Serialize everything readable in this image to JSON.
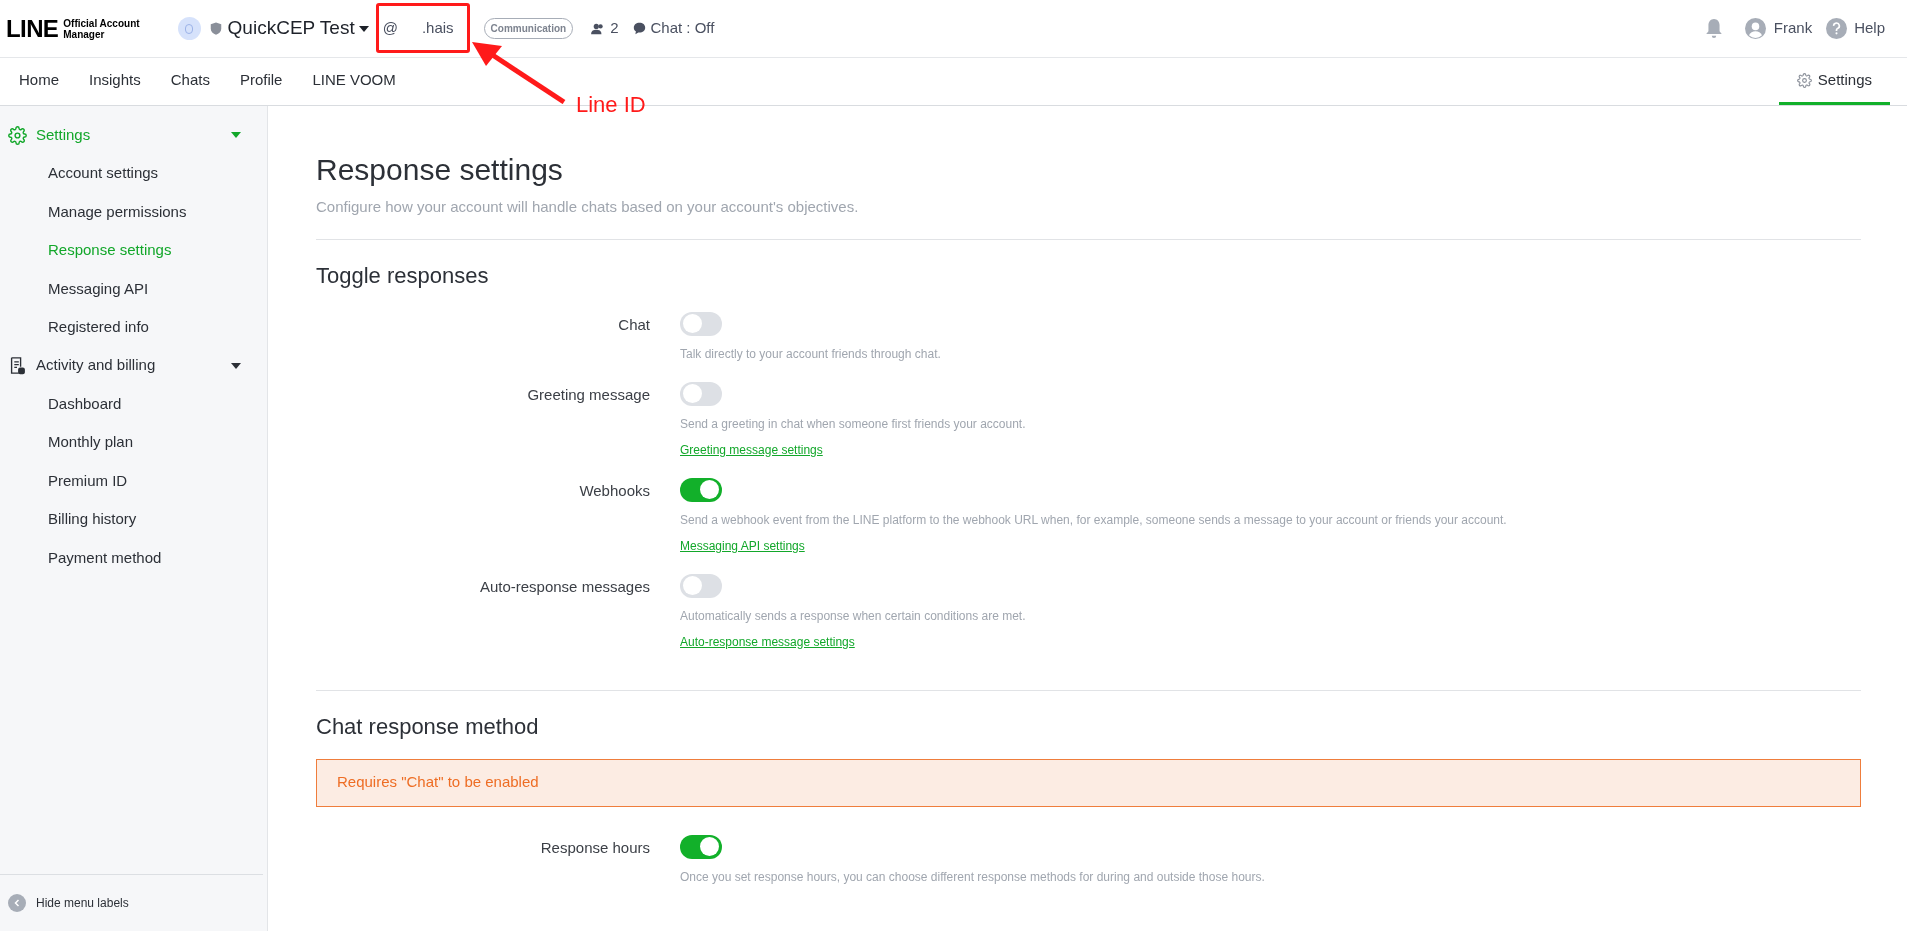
{
  "header": {
    "logo": {
      "mark": "LINE",
      "line1": "Official Account",
      "line2": "Manager"
    },
    "account_name": "QuickCEP Test",
    "line_id": {
      "prefix": "@",
      "suffix": ".hais"
    },
    "plan_badge": "Communication",
    "friends": "2",
    "chat_status": "Chat : Off",
    "user": "Frank",
    "help": "Help"
  },
  "nav_tabs": [
    {
      "label": "Home",
      "selected": false
    },
    {
      "label": "Insights",
      "selected": false
    },
    {
      "label": "Chats",
      "selected": false
    },
    {
      "label": "Profile",
      "selected": false
    },
    {
      "label": "LINE VOOM",
      "selected": false
    }
  ],
  "settings_tab": {
    "label": "Settings",
    "selected": true
  },
  "annotation": {
    "label": "Line ID"
  },
  "sidebar": {
    "groups": [
      {
        "label": "Settings",
        "kind": "settings",
        "expanded": true,
        "selected": true,
        "children": [
          {
            "label": "Account settings",
            "selected": false
          },
          {
            "label": "Manage permissions",
            "selected": false
          },
          {
            "label": "Response settings",
            "selected": true
          },
          {
            "label": "Messaging API",
            "selected": false
          },
          {
            "label": "Registered info",
            "selected": false
          }
        ]
      },
      {
        "label": "Activity and billing",
        "kind": "billing",
        "expanded": true,
        "selected": false,
        "children": [
          {
            "label": "Dashboard",
            "selected": false
          },
          {
            "label": "Monthly plan",
            "selected": false
          },
          {
            "label": "Premium ID",
            "selected": false
          },
          {
            "label": "Billing history",
            "selected": false
          },
          {
            "label": "Payment method",
            "selected": false
          }
        ]
      }
    ],
    "footer": "Hide menu labels"
  },
  "page": {
    "title": "Response settings",
    "subtitle": "Configure how your account will handle chats based on your account's objectives.",
    "sections": [
      {
        "title": "Toggle responses",
        "rows": [
          {
            "label": "Chat",
            "on": false,
            "description": "Talk directly to your account friends through chat."
          },
          {
            "label": "Greeting message",
            "on": false,
            "description": "Send a greeting in chat when someone first friends your account.",
            "link": "Greeting message settings"
          },
          {
            "label": "Webhooks",
            "on": true,
            "description": "Send a webhook event from the LINE platform to the webhook URL when, for example, someone sends a message to your account or friends your account.",
            "link": "Messaging API settings"
          },
          {
            "label": "Auto-response messages",
            "on": false,
            "description": "Automatically sends a response when certain conditions are met.",
            "link": "Auto-response message settings"
          }
        ]
      },
      {
        "title": "Chat response method",
        "alert": "Requires \"Chat\" to be enabled",
        "rows": [
          {
            "label": "Response hours",
            "on": true,
            "description": "Once you set response hours, you can choose different response methods for during and outside those hours."
          }
        ]
      }
    ]
  }
}
